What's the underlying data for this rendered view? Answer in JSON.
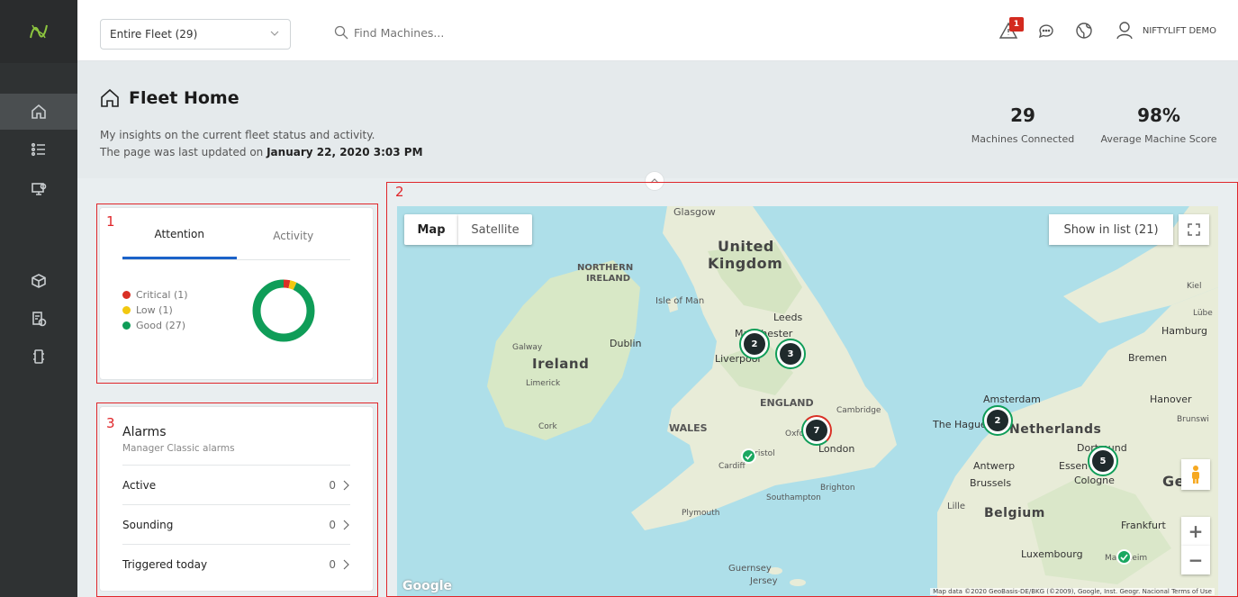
{
  "topbar": {
    "fleet_select": "Entire Fleet (29)",
    "search_placeholder": "Find Machines...",
    "alert_count": "1",
    "user_name": "NIFTYLIFT DEMO"
  },
  "header": {
    "title": "Fleet Home",
    "subtitle_line1": "My insights on the current fleet status and activity.",
    "subtitle_line2_prefix": "The page was last updated on ",
    "subtitle_line2_date": "January 22, 2020 3:03 PM",
    "kpis": [
      {
        "value": "29",
        "label": "Machines Connected"
      },
      {
        "value": "98%",
        "label": "Average Machine Score"
      }
    ]
  },
  "annotations": [
    "1",
    "2",
    "3"
  ],
  "status_panel": {
    "tabs": [
      "Attention",
      "Activity"
    ],
    "active_tab": "Attention",
    "legend": [
      {
        "label": "Critical (1)",
        "color": "#d93025",
        "count": 1
      },
      {
        "label": "Low (1)",
        "color": "#f2c80f",
        "count": 1
      },
      {
        "label": "Good (27)",
        "color": "#0f9d58",
        "count": 27
      }
    ]
  },
  "alarms": {
    "title": "Alarms",
    "subtitle": "Manager Classic alarms",
    "rows": [
      {
        "label": "Active",
        "count": "0"
      },
      {
        "label": "Sounding",
        "count": "0"
      },
      {
        "label": "Triggered today",
        "count": "0"
      }
    ]
  },
  "map": {
    "type_buttons": [
      "Map",
      "Satellite"
    ],
    "active_type": "Map",
    "show_in_list": "Show in list (21)",
    "zoom_in": "+",
    "zoom_out": "−",
    "google_logo": "Google",
    "attribution": "Map data ©2020 GeoBasis-DE/BKG (©2009), Google, Inst. Geogr. Nacional   Terms of Use",
    "labels": {
      "glasgow": "Glasgow",
      "united_kingdom_1": "United",
      "united_kingdom_2": "Kingdom",
      "northern_ireland_1": "NORTHERN",
      "northern_ireland_2": "IRELAND",
      "isle_of_man": "Isle of Man",
      "leeds": "Leeds",
      "manchester": "Manchester",
      "liverpool": "Liverpool",
      "dublin": "Dublin",
      "galway": "Galway",
      "ireland": "Ireland",
      "limerick": "Limerick",
      "cork": "Cork",
      "england": "ENGLAND",
      "cambridge": "Cambridge",
      "wales": "WALES",
      "oxford": "Oxford",
      "london": "London",
      "bristol": "Bristol",
      "cardiff": "Cardiff",
      "brighton": "Brighton",
      "southampton": "Southampton",
      "plymouth": "Plymouth",
      "guernsey": "Guernsey",
      "jersey": "Jersey",
      "amsterdam": "Amsterdam",
      "the_hague": "The Hague",
      "netherlands": "Netherlands",
      "antwerp": "Antwerp",
      "brussels": "Brussels",
      "belgium": "Belgium",
      "lille": "Lille",
      "essen": "Essen",
      "dortmund": "Dortmund",
      "cologne": "Cologne",
      "hanover": "Hanover",
      "bremen": "Bremen",
      "hamburg": "Hamburg",
      "kiel": "Kiel",
      "lubeck": "Lübe",
      "brunswick": "Brunswi",
      "frankfurt": "Frankfurt",
      "luxembourg": "Luxembourg",
      "mannheim": "Mannheim",
      "germany": "Ge"
    },
    "clusters": [
      {
        "count": "2",
        "place": "Manchester west"
      },
      {
        "count": "3",
        "place": "Manchester east"
      },
      {
        "count": "7",
        "place": "Oxford"
      },
      {
        "count": "2",
        "place": "The Hague"
      },
      {
        "count": "5",
        "place": "Dortmund"
      }
    ]
  }
}
